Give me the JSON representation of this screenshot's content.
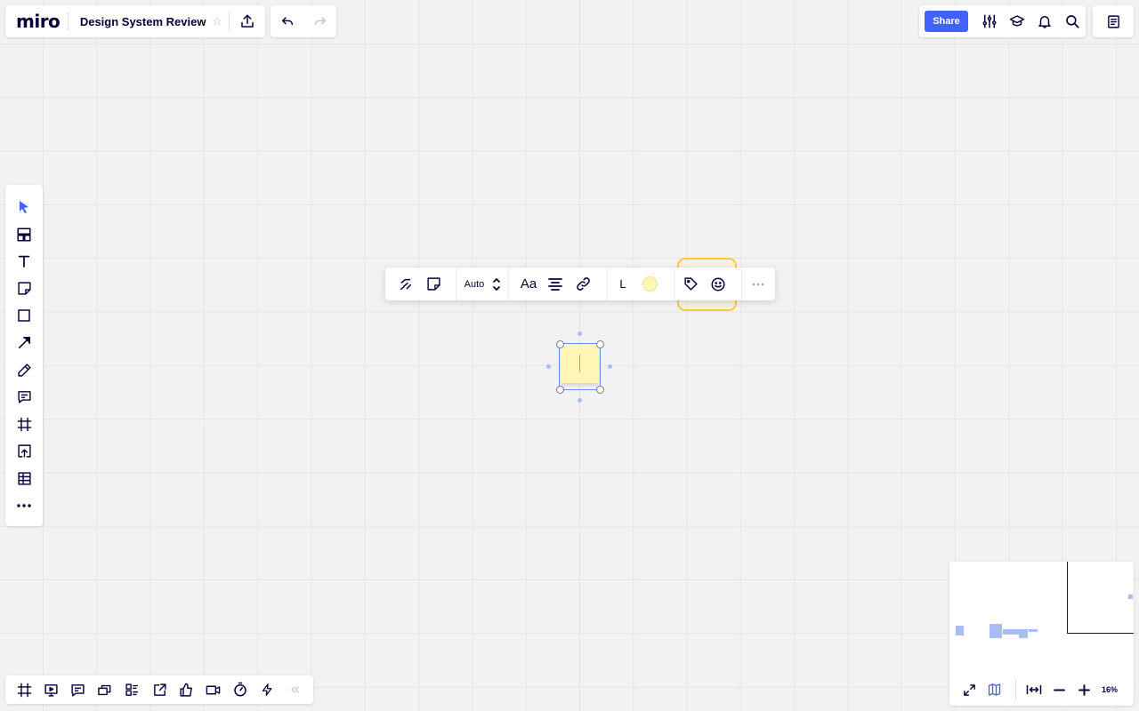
{
  "app": {
    "logo": "miro",
    "board_title": "Design System Review"
  },
  "header": {
    "share_label": "Share",
    "icons": [
      "upload-icon",
      "undo-icon",
      "redo-icon",
      "settings-sliders-icon",
      "learning-cap-icon",
      "notification-bell-icon",
      "search-icon",
      "notes-icon"
    ]
  },
  "left_toolbar": {
    "tools": [
      "select",
      "templates",
      "text",
      "sticky-note",
      "shape",
      "connection-line",
      "pen",
      "comment",
      "frame",
      "upload",
      "table",
      "more"
    ]
  },
  "context_toolbar": {
    "size_label": "Auto",
    "font_label": "Aa",
    "font_size": "L",
    "sticky_color": "#fff6b6",
    "highlighted_buttons": [
      "tag",
      "emoji-reaction"
    ]
  },
  "bottom_toolbar": {
    "tools": [
      "frames",
      "presentation",
      "comments",
      "cards",
      "kanban",
      "share-screen",
      "voting",
      "video-chat",
      "timer",
      "activity",
      "collapse"
    ]
  },
  "minimap": {
    "zoom_level": "16%"
  },
  "colors": {
    "accent": "#4262ff",
    "highlight": "#fcc93a",
    "sticky": "#fff6b6",
    "selection": "#6d8cf2"
  }
}
